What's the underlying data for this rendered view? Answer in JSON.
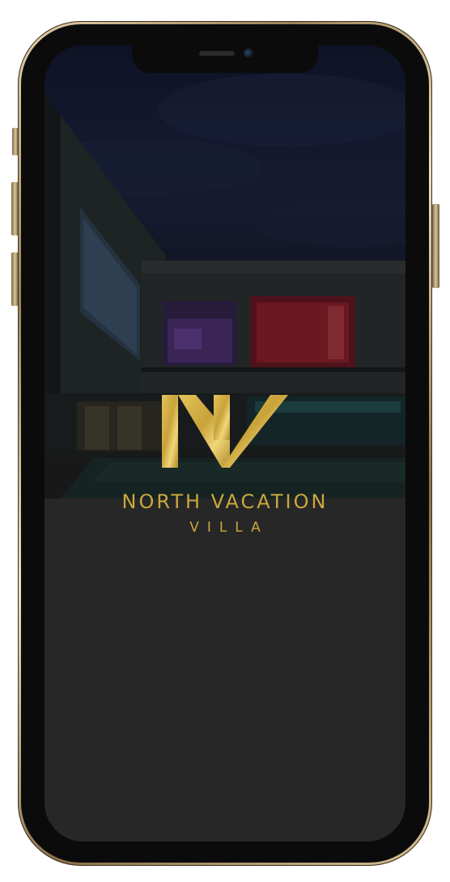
{
  "app": {
    "brand_name": "NORTH VACATION",
    "brand_sub": "VILLA",
    "logo_letters": "NV",
    "accent_color": "#c9a83e"
  },
  "device": {
    "type": "smartphone",
    "frame_color": "#d9c39a",
    "screen_background": "#272727"
  },
  "background": {
    "subject": "modern villa at night with pool"
  }
}
